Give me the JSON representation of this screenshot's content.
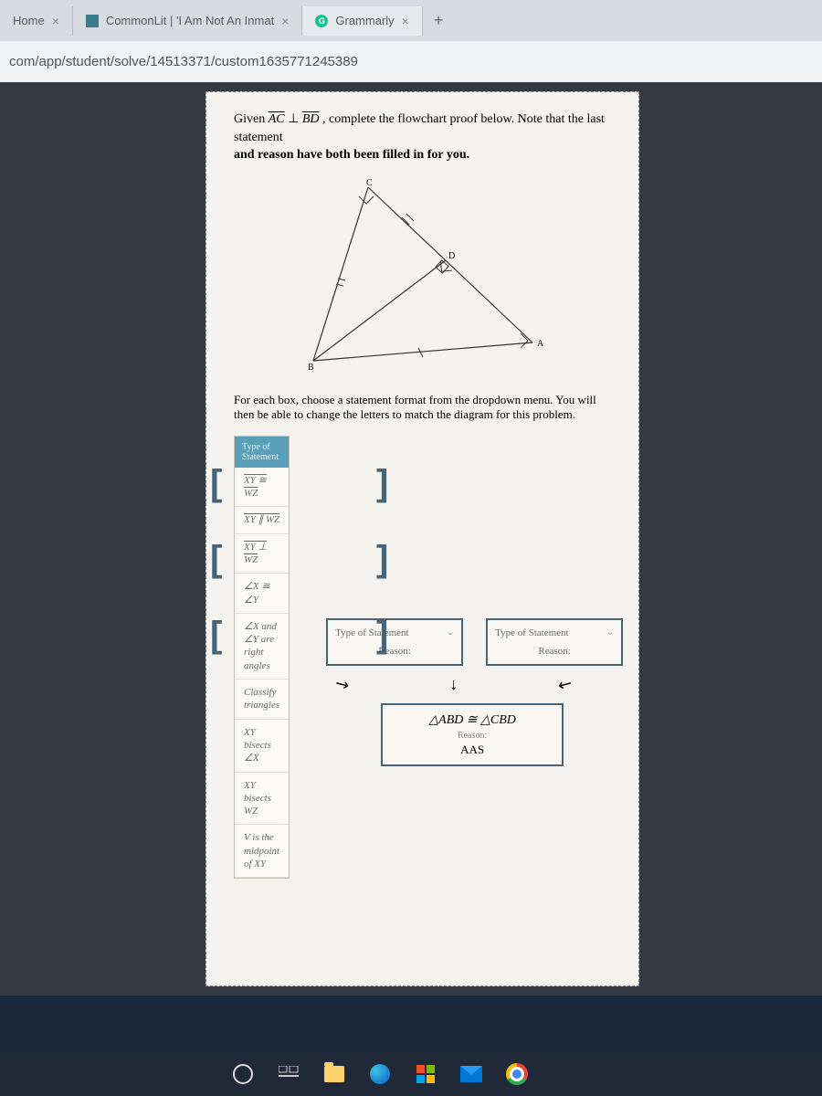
{
  "tabs": {
    "home": "Home",
    "commonlit": "CommonLit | 'I Am Not An Inmat",
    "grammarly": "Grammarly"
  },
  "url": "com/app/student/solve/14513371/custom1635771245389",
  "problem": {
    "given_prefix": "Given",
    "given_seg1": "AC",
    "perp": "⊥",
    "given_seg2": "BD",
    "given_suffix": ", complete the flowchart proof below. Note that the last statement",
    "given_line2": "and reason have both been filled in for you.",
    "sub": "For each box, choose a statement format from the dropdown menu. You will then be able to change the letters to match the diagram for this problem."
  },
  "diagram_labels": {
    "A": "A",
    "B": "B",
    "C": "C",
    "D": "D"
  },
  "dropdown": {
    "header": "Type of Statement",
    "items": [
      "XY ≅ WZ",
      "XY ∥ WZ",
      "XY ⊥ WZ",
      "∠X ≅ ∠Y",
      "∠X and ∠Y are right angles",
      "Classify triangles",
      "XY bisects ∠X",
      "XY bisects WZ",
      "V is the midpoint of XY"
    ]
  },
  "box": {
    "type_label": "Type of Statement",
    "reason_label": "Reason:"
  },
  "final": {
    "statement": "△ABD ≅ △CBD",
    "reason_label": "Reason:",
    "reason": "AAS"
  }
}
